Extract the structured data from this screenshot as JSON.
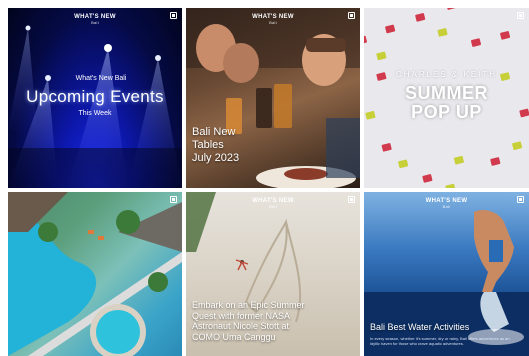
{
  "brand": {
    "name": "WHAT'S NEW",
    "sub": "Bali"
  },
  "tiles": [
    {
      "id": "upcoming-events",
      "small": "What's New Bali",
      "title": "Upcoming Events",
      "subtitle": "This Week"
    },
    {
      "id": "new-tables",
      "title_lines": [
        "Bali New",
        "Tables",
        "July 2023"
      ]
    },
    {
      "id": "summer-popup",
      "brand_line": "CHARLES & KEITH",
      "title_lines": [
        "SUMMER",
        "POP UP"
      ]
    },
    {
      "id": "pool-resort"
    },
    {
      "id": "summer-quest",
      "title_lines": [
        "Embark on an Epic Summer",
        "Quest with former NASA",
        "Astronaut Nicole Stott at",
        "COMO Uma Canggu"
      ]
    },
    {
      "id": "water-activities",
      "title": "Bali Best Water Activities",
      "body": "In every season, whether it's summer, dry or rainy, Bali offers adventures as an idyllic haven for those who crave aquatic adventures."
    }
  ]
}
